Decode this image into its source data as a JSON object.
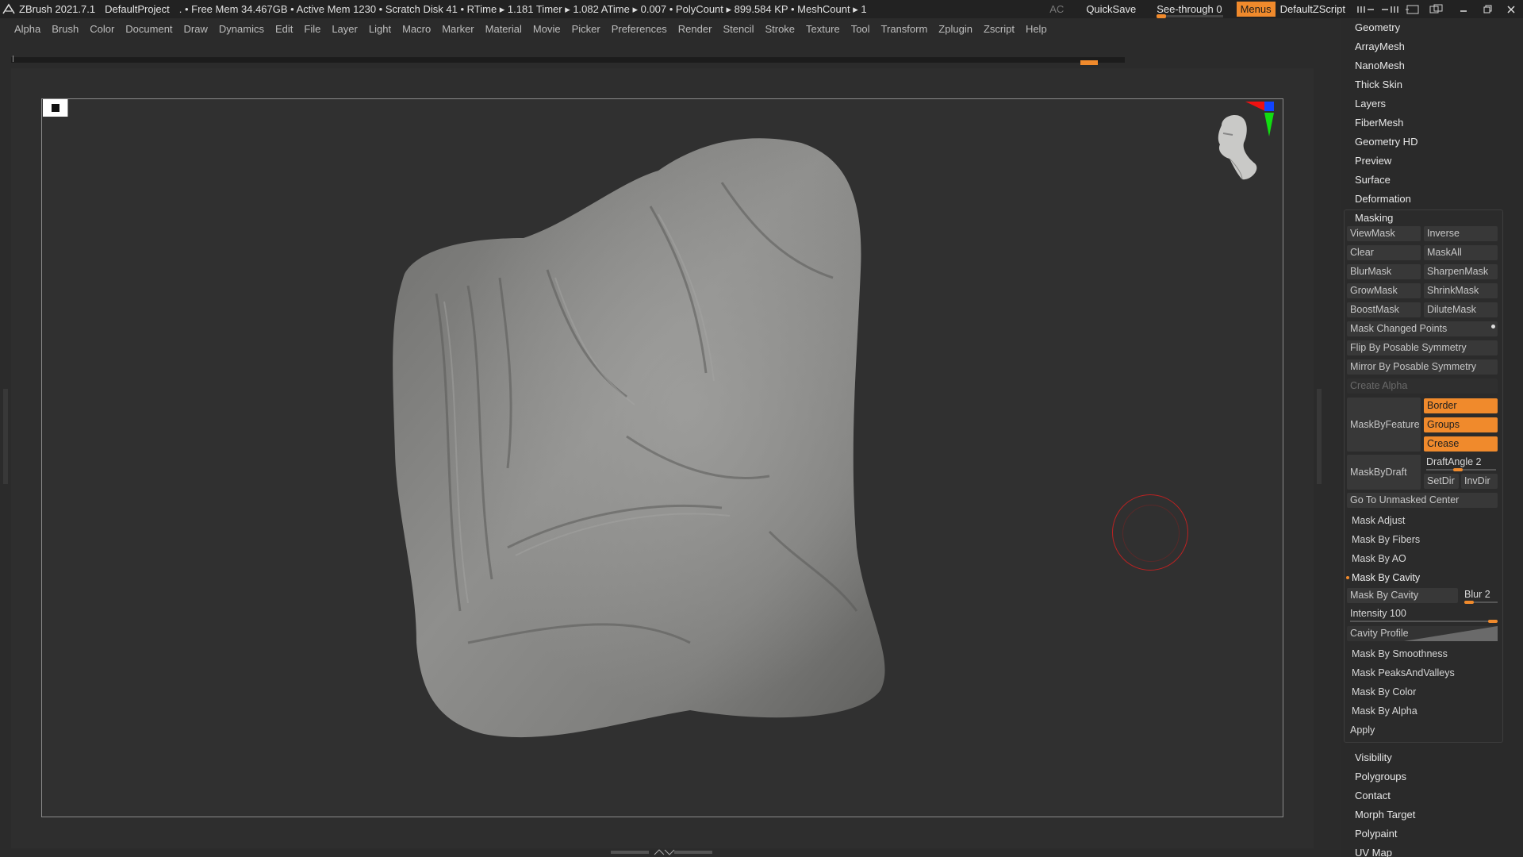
{
  "titlebar": {
    "app": "ZBrush 2021.7.1",
    "project": "DefaultProject",
    "stats": ". • Free Mem 34.467GB • Active Mem 1230 • Scratch Disk 41 •  RTime ▸ 1.181 Timer ▸ 1.082 ATime ▸ 0.007 • PolyCount ▸ 899.584 KP  • MeshCount ▸ 1",
    "ac": "AC",
    "quicksave": "QuickSave",
    "see_through": "See-through  0",
    "see_through_value": 0,
    "menus": "Menus",
    "script": "DefaultZScript"
  },
  "menubar": [
    "Alpha",
    "Brush",
    "Color",
    "Document",
    "Draw",
    "Dynamics",
    "Edit",
    "File",
    "Layer",
    "Light",
    "Macro",
    "Marker",
    "Material",
    "Movie",
    "Picker",
    "Preferences",
    "Render",
    "Stencil",
    "Stroke",
    "Texture",
    "Tool",
    "Transform",
    "Zplugin",
    "Zscript",
    "Help"
  ],
  "panel": {
    "top_headers": [
      "Geometry",
      "ArrayMesh",
      "NanoMesh",
      "Thick Skin",
      "Layers",
      "FiberMesh",
      "Geometry HD",
      "Preview",
      "Surface",
      "Deformation"
    ],
    "masking": {
      "title": "Masking",
      "pairs": [
        [
          "ViewMask",
          "Inverse"
        ],
        [
          "Clear",
          "MaskAll"
        ],
        [
          "BlurMask",
          "SharpenMask"
        ],
        [
          "GrowMask",
          "ShrinkMask"
        ],
        [
          "BoostMask",
          "DiluteMask"
        ]
      ],
      "mask_changed": "Mask Changed Points",
      "flip": "Flip By Posable Symmetry",
      "mirror": "Mirror By Posable Symmetry",
      "create_alpha": "Create Alpha",
      "maskbyfeature": "MaskByFeature",
      "border": "Border",
      "groups": "Groups",
      "crease": "Crease",
      "maskbydraft": "MaskByDraft",
      "draftangle": "DraftAngle 2",
      "setdir": "SetDir",
      "invdir": "InvDir",
      "goto_center": "Go To Unmasked Center",
      "mask_adjust": "Mask Adjust",
      "mask_fibers": "Mask By Fibers",
      "mask_ao": "Mask By AO",
      "mask_cavity_header": "Mask By Cavity",
      "mask_cavity_btn": "Mask By Cavity",
      "blur": "Blur 2",
      "intensity": "Intensity 100",
      "intensity_value": 100,
      "cavity_profile": "Cavity Profile",
      "mask_smoothness": "Mask By Smoothness",
      "mask_peaks": "Mask PeaksAndValleys",
      "mask_color": "Mask By Color",
      "mask_alpha": "Mask By Alpha",
      "apply": "Apply"
    },
    "bottom_headers": [
      "Visibility",
      "Polygroups",
      "Contact",
      "Morph Target",
      "Polypaint",
      "UV Map"
    ]
  },
  "colors": {
    "accent": "#f08a2c",
    "background": "#2b2b2b",
    "mesh": "#8c8c8a"
  }
}
